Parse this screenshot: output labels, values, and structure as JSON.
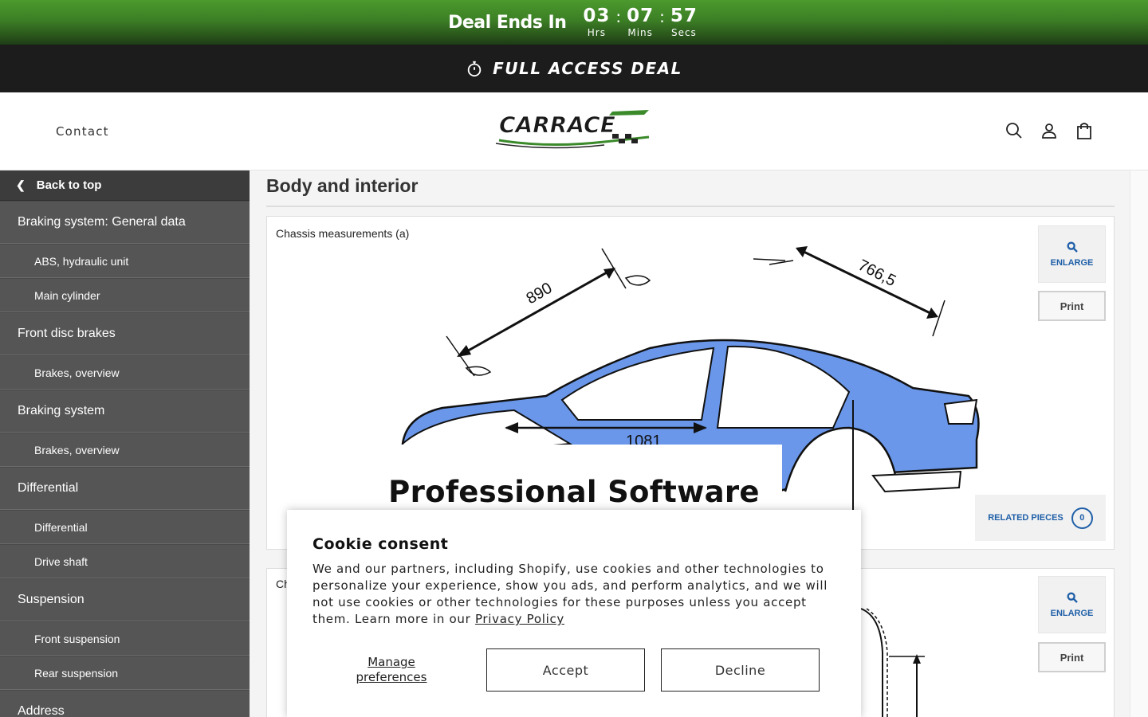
{
  "countdown": {
    "label": "Deal Ends In",
    "hours": "03",
    "hours_label": "Hrs",
    "minutes": "07",
    "minutes_label": "Mins",
    "seconds": "57",
    "seconds_label": "Secs",
    "separator": ":"
  },
  "access_bar": {
    "text": "FULL ACCESS DEAL",
    "icon": "stopwatch-icon"
  },
  "header": {
    "contact_label": "Contact",
    "logo_text": "CARRACE",
    "icons": [
      "search-icon",
      "account-icon",
      "cart-icon"
    ]
  },
  "sidebar": {
    "back_label": "Back to top",
    "items": [
      {
        "label": "Braking system: General data",
        "level": 1
      },
      {
        "label": "ABS, hydraulic unit",
        "level": 2
      },
      {
        "label": "Main cylinder",
        "level": 2
      },
      {
        "label": "Front disc brakes",
        "level": 1
      },
      {
        "label": "Brakes, overview",
        "level": 2
      },
      {
        "label": "Braking system",
        "level": 1
      },
      {
        "label": "Brakes, overview",
        "level": 2
      },
      {
        "label": "Differential",
        "level": 1
      },
      {
        "label": "Differential",
        "level": 2
      },
      {
        "label": "Drive shaft",
        "level": 2
      },
      {
        "label": "Suspension",
        "level": 1
      },
      {
        "label": "Front suspension",
        "level": 2
      },
      {
        "label": "Rear suspension",
        "level": 2
      },
      {
        "label": "Address",
        "level": 1
      }
    ]
  },
  "main": {
    "title": "Body and interior",
    "card1": {
      "title": "Chassis measurements (a)",
      "enlarge_label": "ENLARGE",
      "print_label": "Print",
      "related_label": "RELATED PIECES",
      "related_count": "0",
      "dimensions": [
        "890",
        "766,5",
        "1081"
      ]
    },
    "card2": {
      "title_partial": "Ch",
      "enlarge_label": "ENLARGE",
      "print_label": "Print"
    }
  },
  "promo": {
    "title": "Professional Software"
  },
  "cookie": {
    "title": "Cookie consent",
    "body": "We and our partners, including Shopify, use cookies and other technologies to personalize your experience, show you ads, and perform analytics, and we will not use cookies or other technologies for these purposes unless you accept them. Learn more in our ",
    "link": "Privacy Policy",
    "manage_label": "Manage preferences",
    "accept_label": "Accept",
    "decline_label": "Decline"
  },
  "colors": {
    "brand_green": "#3c7f25",
    "dark_bar": "#1c1c1c",
    "sidebar_bg": "#555555",
    "link_blue": "#1f5fa8",
    "car_blue": "#6a97ea"
  }
}
